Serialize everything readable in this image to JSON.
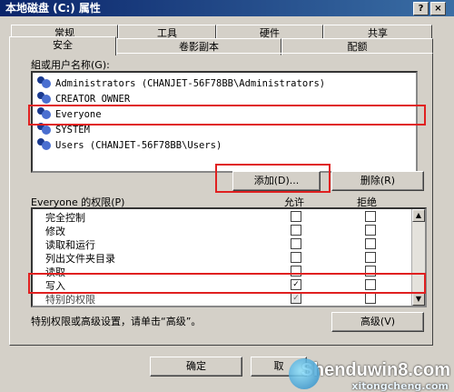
{
  "window": {
    "title": "本地磁盘 (C:) 属性",
    "help": "?",
    "close": "×"
  },
  "tabs": [
    "常规",
    "工具",
    "硬件",
    "共享",
    "安全",
    "卷影副本",
    "配额"
  ],
  "groups_label": "組或用户名称(G):",
  "users": [
    "Administrators (CHANJET-56F78BB\\Administrators)",
    "CREATOR OWNER",
    "Everyone",
    "SYSTEM",
    "Users (CHANJET-56F78BB\\Users)"
  ],
  "buttons": {
    "add": "添加(D)...",
    "remove": "删除(R)",
    "advanced": "高级(V)",
    "ok": "确定",
    "cancel": "取"
  },
  "perm_header": {
    "label": "Everyone 的权限(P)",
    "allow": "允许",
    "deny": "拒绝"
  },
  "permissions": [
    {
      "name": "完全控制",
      "allow": false,
      "deny": false
    },
    {
      "name": "修改",
      "allow": false,
      "deny": false
    },
    {
      "name": "读取和运行",
      "allow": false,
      "deny": false
    },
    {
      "name": "列出文件夹目录",
      "allow": false,
      "deny": false
    },
    {
      "name": "读取",
      "allow": false,
      "deny": false
    },
    {
      "name": "写入",
      "allow": true,
      "deny": false
    },
    {
      "name": "特别的权限",
      "allow": true,
      "deny": false
    }
  ],
  "advanced_hint": "特别权限或高级设置，请单击“高级”。",
  "watermark": {
    "main": "Shenduwin8.com",
    "sub": "xitongcheng.com"
  }
}
